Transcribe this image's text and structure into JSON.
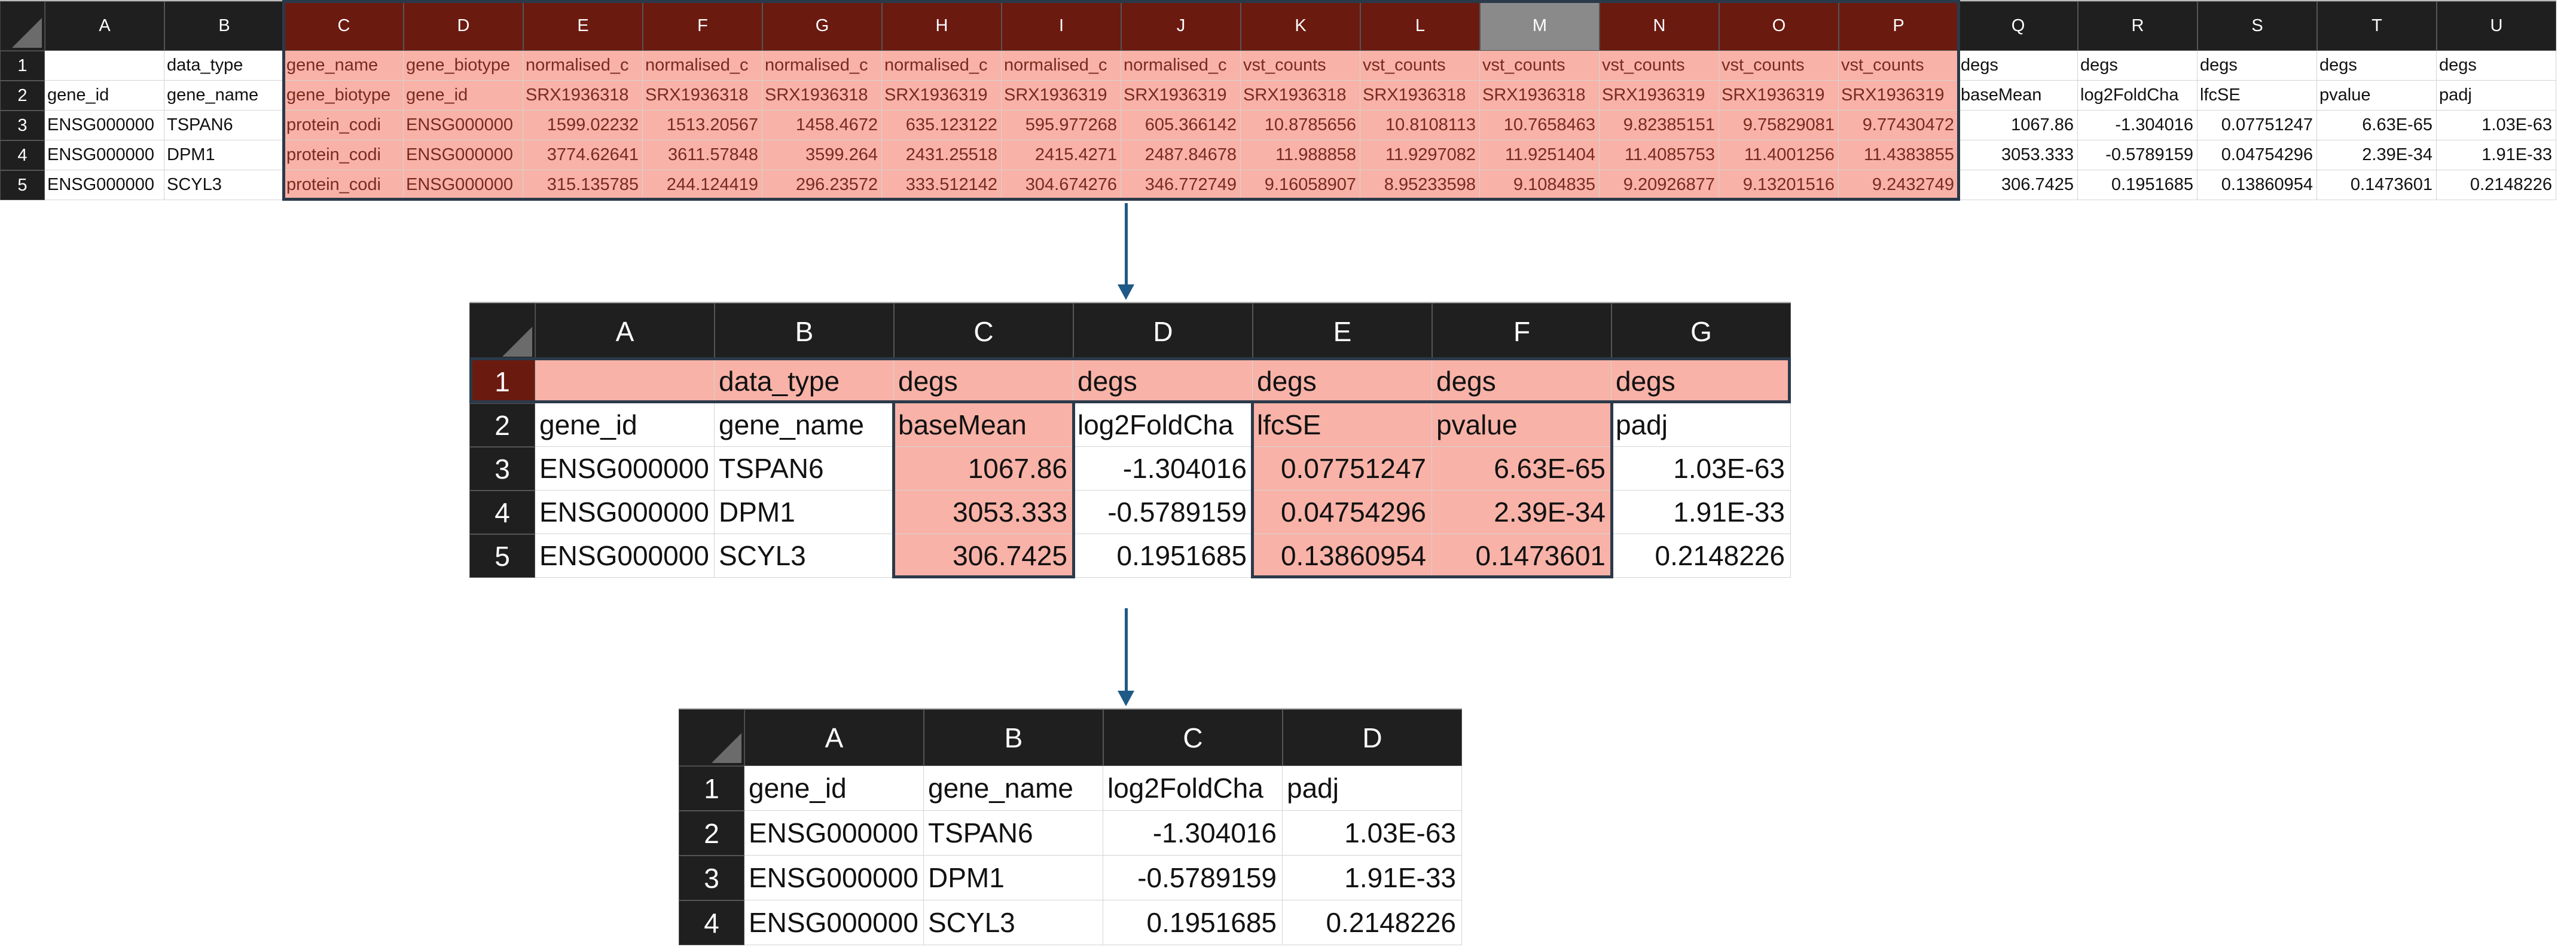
{
  "top": {
    "col_headers": [
      "A",
      "B",
      "C",
      "D",
      "E",
      "F",
      "G",
      "H",
      "I",
      "J",
      "K",
      "L",
      "M",
      "N",
      "O",
      "P",
      "Q",
      "R",
      "S",
      "T",
      "U"
    ],
    "row_headers": [
      "1",
      "2",
      "3",
      "4",
      "5"
    ],
    "rows": [
      [
        "",
        "data_type",
        "gene_name",
        "gene_biotype",
        "normalised_c",
        "normalised_c",
        "normalised_c",
        "normalised_c",
        "normalised_c",
        "normalised_c",
        "vst_counts",
        "vst_counts",
        "vst_counts",
        "vst_counts",
        "vst_counts",
        "vst_counts",
        "degs",
        "degs",
        "degs",
        "degs",
        "degs"
      ],
      [
        "gene_id",
        "gene_name",
        "gene_biotype",
        "gene_id",
        "SRX1936318",
        "SRX1936318",
        "SRX1936318",
        "SRX1936319",
        "SRX1936319",
        "SRX1936319",
        "SRX1936318",
        "SRX1936318",
        "SRX1936318",
        "SRX1936319",
        "SRX1936319",
        "SRX1936319",
        "baseMean",
        "log2FoldCha",
        "lfcSE",
        "pvalue",
        "padj"
      ],
      [
        "ENSG000000",
        "TSPAN6",
        "protein_codi",
        "ENSG000000",
        "1599.02232",
        "1513.20567",
        "1458.4672",
        "635.123122",
        "595.977268",
        "605.366142",
        "10.8785656",
        "10.8108113",
        "10.7658463",
        "9.82385151",
        "9.75829081",
        "9.77430472",
        "1067.86",
        "-1.304016",
        "0.07751247",
        "6.63E-65",
        "1.03E-63"
      ],
      [
        "ENSG000000",
        "DPM1",
        "protein_codi",
        "ENSG000000",
        "3774.62641",
        "3611.57848",
        "3599.264",
        "2431.25518",
        "2415.4271",
        "2487.84678",
        "11.988858",
        "11.9297082",
        "11.9251404",
        "11.4085753",
        "11.4001256",
        "11.4383855",
        "3053.333",
        "-0.5789159",
        "0.04754296",
        "2.39E-34",
        "1.91E-33"
      ],
      [
        "ENSG000000",
        "SCYL3",
        "protein_codi",
        "ENSG000000",
        "315.135785",
        "244.124419",
        "296.23572",
        "333.512142",
        "304.674276",
        "346.772749",
        "9.16058907",
        "8.95233598",
        "9.1084835",
        "9.20926877",
        "9.13201516",
        "9.2432749",
        "306.7425",
        "0.1951685",
        "0.13860954",
        "0.1473601",
        "0.2148226"
      ]
    ]
  },
  "middle": {
    "col_headers": [
      "A",
      "B",
      "C",
      "D",
      "E",
      "F",
      "G"
    ],
    "row_headers": [
      "1",
      "2",
      "3",
      "4",
      "5"
    ],
    "rows": [
      [
        "",
        "data_type",
        "degs",
        "degs",
        "degs",
        "degs",
        "degs"
      ],
      [
        "gene_id",
        "gene_name",
        "baseMean",
        "log2FoldCha",
        "lfcSE",
        "pvalue",
        "padj"
      ],
      [
        "ENSG000000",
        "TSPAN6",
        "1067.86",
        "-1.304016",
        "0.07751247",
        "6.63E-65",
        "1.03E-63"
      ],
      [
        "ENSG000000",
        "DPM1",
        "3053.333",
        "-0.5789159",
        "0.04754296",
        "2.39E-34",
        "1.91E-33"
      ],
      [
        "ENSG000000",
        "SCYL3",
        "306.7425",
        "0.1951685",
        "0.13860954",
        "0.1473601",
        "0.2148226"
      ]
    ]
  },
  "bottom": {
    "col_headers": [
      "A",
      "B",
      "C",
      "D"
    ],
    "row_headers": [
      "1",
      "2",
      "3",
      "4"
    ],
    "rows": [
      [
        "gene_id",
        "gene_name",
        "log2FoldCha",
        "padj"
      ],
      [
        "ENSG000000",
        "TSPAN6",
        "-1.304016",
        "1.03E-63"
      ],
      [
        "ENSG000000",
        "DPM1",
        "-0.5789159",
        "1.91E-33"
      ],
      [
        "ENSG000000",
        "SCYL3",
        "0.1951685",
        "0.2148226"
      ]
    ]
  },
  "colors": {
    "header_bg": "#1f1f1f",
    "selected_header": "#6b1a10",
    "highlight": "#f8b2a7",
    "arrow": "#1f5a86",
    "outline": "#2b3a4a"
  }
}
